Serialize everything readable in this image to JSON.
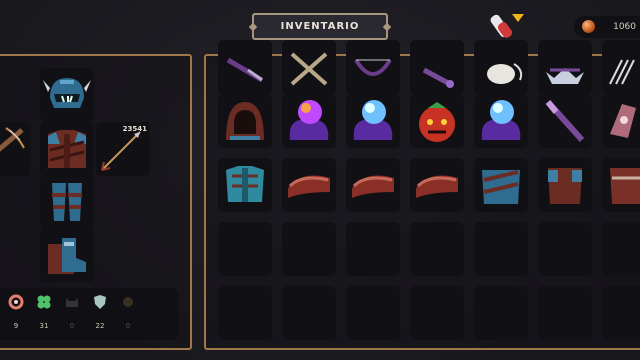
{
  "header": {
    "title": "INVENTARIO",
    "gold": "1060",
    "gold_icon": "copper-coin-icon",
    "potion_icon": "potion-vial-icon"
  },
  "equipment": {
    "helmet": "horned-helmet-icon",
    "weapon_left": "crossbow-icon",
    "chest": "leather-armor-icon",
    "ranged": "arrow-icon",
    "ranged_count": "23541",
    "legs": "greaves-icon",
    "boots": "boots-icon"
  },
  "stats": [
    {
      "icon": "life-ring-icon",
      "value": "9",
      "color": "#e57d70"
    },
    {
      "icon": "clover-icon",
      "value": "31",
      "color": "#4fc36a"
    },
    {
      "icon": "cat-head-icon",
      "value": "0",
      "color": "#333333"
    },
    {
      "icon": "shield-icon",
      "value": "22",
      "color": "#a8c7bf"
    },
    {
      "icon": "flame-icon",
      "value": "0",
      "color": "#3a3022"
    }
  ],
  "inventory": {
    "row0": [
      "sword-icon",
      "crossed-blades-icon",
      "bow-icon",
      "staff-icon",
      "garlic-icon",
      "crown-icon",
      "claw-icon"
    ],
    "row1": [
      "red-hood-icon",
      "purple-orb-slime-icon",
      "blue-orb-slime-icon",
      "tomato-monster-icon",
      "blue-orb-slime-icon",
      "purple-staff-icon",
      "pink-pendant-icon"
    ],
    "row2": [
      "teal-chestplate-icon",
      "meat-slab-icon",
      "meat-slab-icon",
      "meat-slab-icon",
      "blue-armor-icon",
      "brown-armor-icon",
      "red-armor-icon"
    ]
  }
}
